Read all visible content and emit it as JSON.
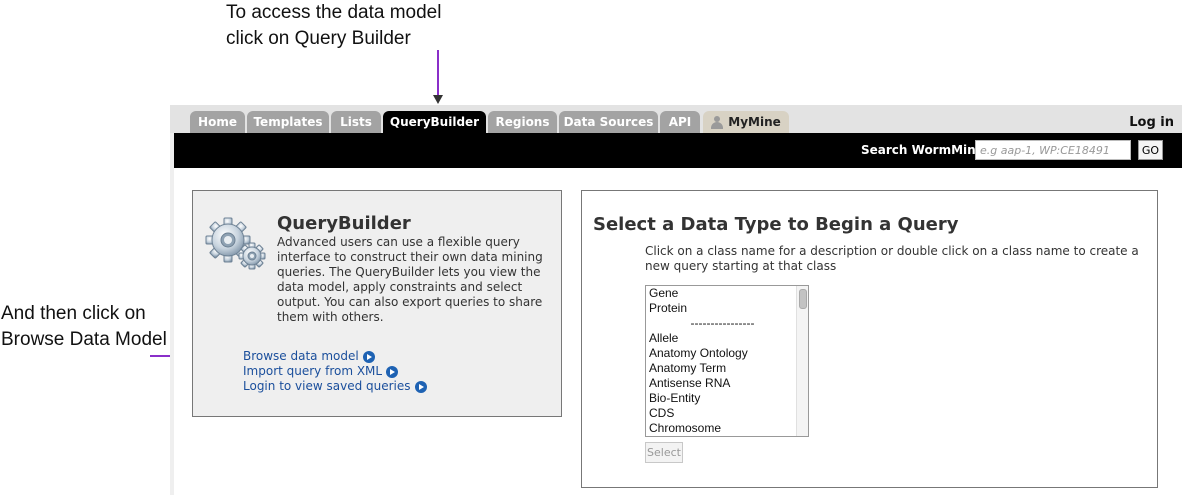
{
  "annotations": {
    "top_line1": "To access the data model",
    "top_line2": "click on Query Builder",
    "left_line1": "And then click on",
    "left_line2": "Browse Data Model"
  },
  "nav": {
    "tabs": [
      "Home",
      "Templates",
      "Lists",
      "QueryBuilder",
      "Regions",
      "Data Sources",
      "API",
      "MyMine"
    ],
    "active_tab": "QueryBuilder",
    "login": "Log in"
  },
  "search": {
    "label": "Search WormMine",
    "placeholder": "e.g aap-1, WP:CE18491",
    "go_label": "GO"
  },
  "querybuilder": {
    "title": "QueryBuilder",
    "description": "Advanced users can use a flexible query interface to construct their own data mining queries. The QueryBuilder lets you view the data model, apply constraints and select output. You can also export queries to share them with others.",
    "links": [
      "Browse data model",
      "Import query from XML",
      "Login to view saved queries"
    ]
  },
  "datatype": {
    "title": "Select a Data Type to Begin a Query",
    "description": "Click on a class name for a description or double click on a class name to create a new query starting at that class",
    "items": [
      "Gene",
      "Protein",
      "----------------",
      "Allele",
      "Anatomy Ontology",
      "Anatomy Term",
      "Antisense RNA",
      "Bio-Entity",
      "CDS",
      "Chromosome"
    ],
    "select_label": "Select"
  },
  "colors": {
    "accent_arrow": "#8a2fc9",
    "tab_inactive": "#a3a3a3",
    "tab_active": "#000000",
    "link": "#1b4f9c"
  }
}
